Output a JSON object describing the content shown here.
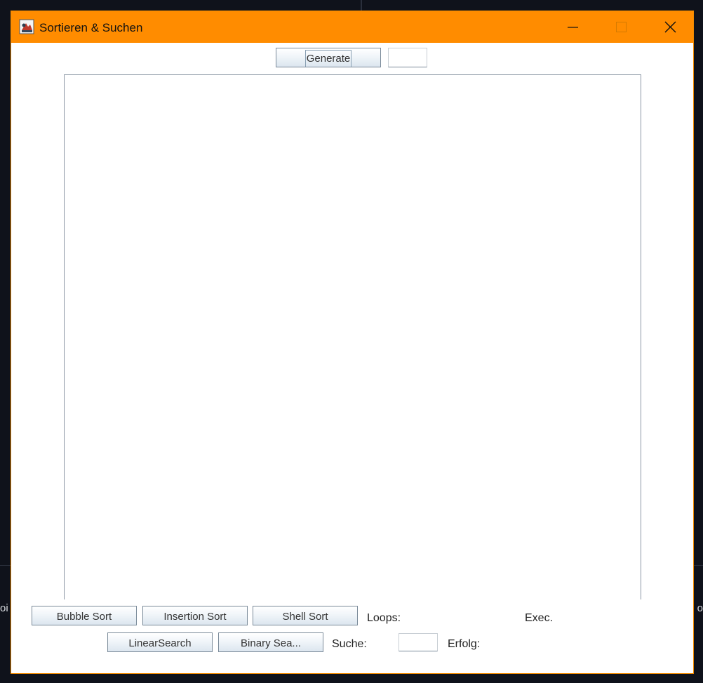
{
  "window": {
    "title": "Sortieren & Suchen",
    "accent_color": "#ff8c00",
    "icon": "java-app-icon"
  },
  "top_toolbar": {
    "generate_label": "Generate",
    "count_value": ""
  },
  "sort_row": {
    "bubble_label": "Bubble Sort",
    "insertion_label": "Insertion Sort",
    "shell_label": "Shell Sort",
    "loops_label": "Loops:",
    "loops_value": "",
    "exec_label": "Exec.",
    "exec_value": ""
  },
  "search_row": {
    "linear_label": "LinearSearch",
    "binary_label": "Binary Sea...",
    "search_label": "Suche:",
    "search_value": "",
    "success_label": "Erfolg:",
    "success_value": ""
  },
  "desktop": {
    "left_edge_text": "oi",
    "right_edge_text": "o"
  }
}
